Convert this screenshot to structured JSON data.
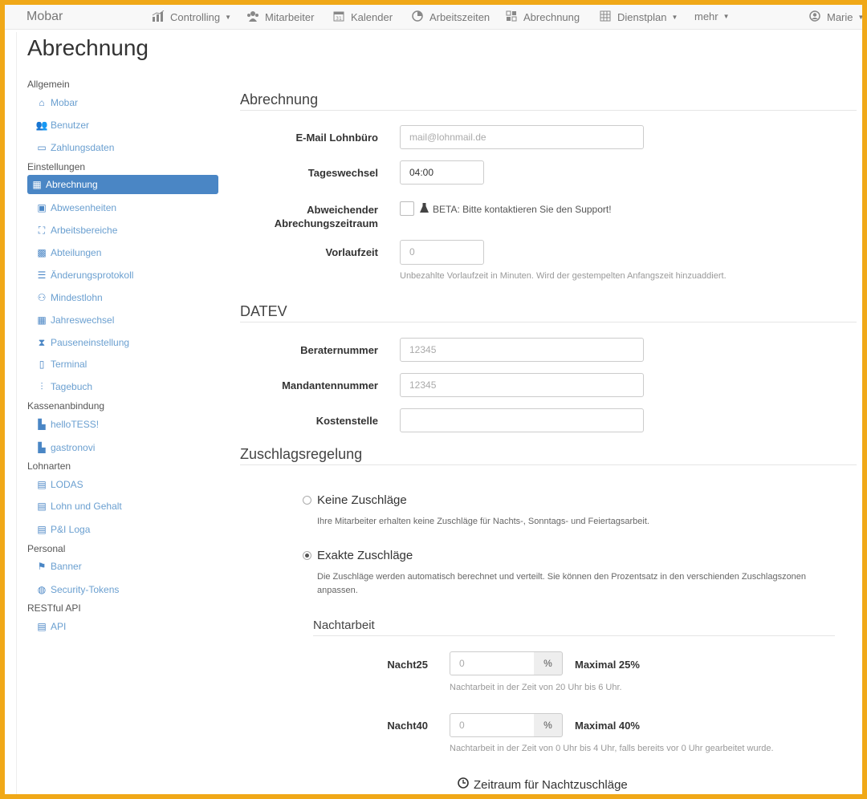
{
  "navbar": {
    "brand": "Mobar",
    "items": [
      {
        "label": "Controlling",
        "icon": "chart-icon",
        "dropdown": true
      },
      {
        "label": "Mitarbeiter",
        "icon": "users-icon",
        "dropdown": false
      },
      {
        "label": "Kalender",
        "icon": "calendar-icon",
        "dropdown": false
      },
      {
        "label": "Arbeitszeiten",
        "icon": "clock-icon",
        "dropdown": false
      },
      {
        "label": "Abrechnung",
        "icon": "grid-icon",
        "dropdown": false
      },
      {
        "label": "Dienstplan",
        "icon": "schedule-icon",
        "dropdown": true
      },
      {
        "label": "mehr",
        "icon": "",
        "dropdown": true
      }
    ],
    "user": "Marie"
  },
  "page_title": "Abrechnung",
  "sidebar": {
    "groups": [
      {
        "title": "Allgemein",
        "items": [
          {
            "label": "Mobar",
            "icon": "home-icon"
          },
          {
            "label": "Benutzer",
            "icon": "users-icon"
          },
          {
            "label": "Zahlungsdaten",
            "icon": "credit-card-icon"
          }
        ]
      },
      {
        "title": "Einstellungen",
        "items": [
          {
            "label": "Abrechnung",
            "icon": "grid-icon",
            "active": true
          },
          {
            "label": "Abwesenheiten",
            "icon": "calendar-icon"
          },
          {
            "label": "Arbeitsbereiche",
            "icon": "area-icon"
          },
          {
            "label": "Abteilungen",
            "icon": "department-icon"
          },
          {
            "label": "Änderungsprotokoll",
            "icon": "list-icon"
          },
          {
            "label": "Mindestlohn",
            "icon": "wage-icon"
          },
          {
            "label": "Jahreswechsel",
            "icon": "calendar-icon"
          },
          {
            "label": "Pauseneinstellung",
            "icon": "hourglass-icon"
          },
          {
            "label": "Terminal",
            "icon": "tablet-icon"
          },
          {
            "label": "Tagebuch",
            "icon": "chart-icon"
          }
        ]
      },
      {
        "title": "Kassenanbindung",
        "items": [
          {
            "label": "helloTESS!",
            "icon": "register-icon"
          },
          {
            "label": "gastronovi",
            "icon": "register-icon"
          }
        ]
      },
      {
        "title": "Lohnarten",
        "items": [
          {
            "label": "LODAS",
            "icon": "file-icon"
          },
          {
            "label": "Lohn und Gehalt",
            "icon": "file-icon"
          },
          {
            "label": "P&I Loga",
            "icon": "file-icon"
          }
        ]
      },
      {
        "title": "Personal",
        "items": [
          {
            "label": "Banner",
            "icon": "flag-icon"
          }
        ]
      },
      {
        "title": "",
        "items": [
          {
            "label": "Security-Tokens",
            "icon": "key-icon"
          }
        ]
      },
      {
        "title": "RESTful API",
        "items": [
          {
            "label": "API",
            "icon": "file-icon"
          }
        ]
      }
    ]
  },
  "form": {
    "section_abrechnung": "Abrechnung",
    "email_label": "E-Mail Lohnbüro",
    "email_placeholder": "mail@lohnmail.de",
    "tageswechsel_label": "Tageswechsel",
    "tageswechsel_value": "04:00",
    "abweichend_label_1": "Abweichender",
    "abweichend_label_2": "Abrechungszeitraum",
    "beta_text": "BETA: Bitte kontaktieren Sie den Support!",
    "vorlaufzeit_label": "Vorlaufzeit",
    "vorlaufzeit_placeholder": "0",
    "vorlaufzeit_help": "Unbezahlte Vorlaufzeit in Minuten. Wird der gestempelten Anfangszeit hinzuaddiert.",
    "section_datev": "DATEV",
    "berater_label": "Beraternummer",
    "berater_placeholder": "12345",
    "mandant_label": "Mandantennummer",
    "mandant_placeholder": "12345",
    "kosten_label": "Kostenstelle",
    "kosten_placeholder": "",
    "section_zuschlag": "Zuschlagsregelung",
    "keine_label": "Keine Zuschläge",
    "keine_help": "Ihre Mitarbeiter erhalten keine Zuschläge für Nachts-, Sonntags- und Feiertagsarbeit.",
    "exakte_label": "Exakte Zuschläge",
    "exakte_help_1": "Die Zuschläge werden automatisch berechnet und verteilt. Sie können den Prozentsatz in den verschienden Zuschlagszonen",
    "exakte_help_2": "anpassen.",
    "selected_option": "exakte",
    "section_nacht": "Nachtarbeit",
    "nacht25_label": "Nacht25",
    "nacht25_placeholder": "0",
    "nacht25_max": "Maximal 25%",
    "nacht25_help": "Nachtarbeit in der Zeit von 20 Uhr bis 6 Uhr.",
    "nacht40_label": "Nacht40",
    "nacht40_placeholder": "0",
    "nacht40_max": "Maximal 40%",
    "nacht40_help": "Nachtarbeit in der Zeit von 0 Uhr bis 4 Uhr, falls bereits vor 0 Uhr gearbeitet wurde.",
    "percent": "%",
    "zeitraum_label": "Zeitraum für Nachtzuschläge"
  },
  "colors": {
    "accent": "#4a86c5",
    "frame": "#f0a818"
  }
}
